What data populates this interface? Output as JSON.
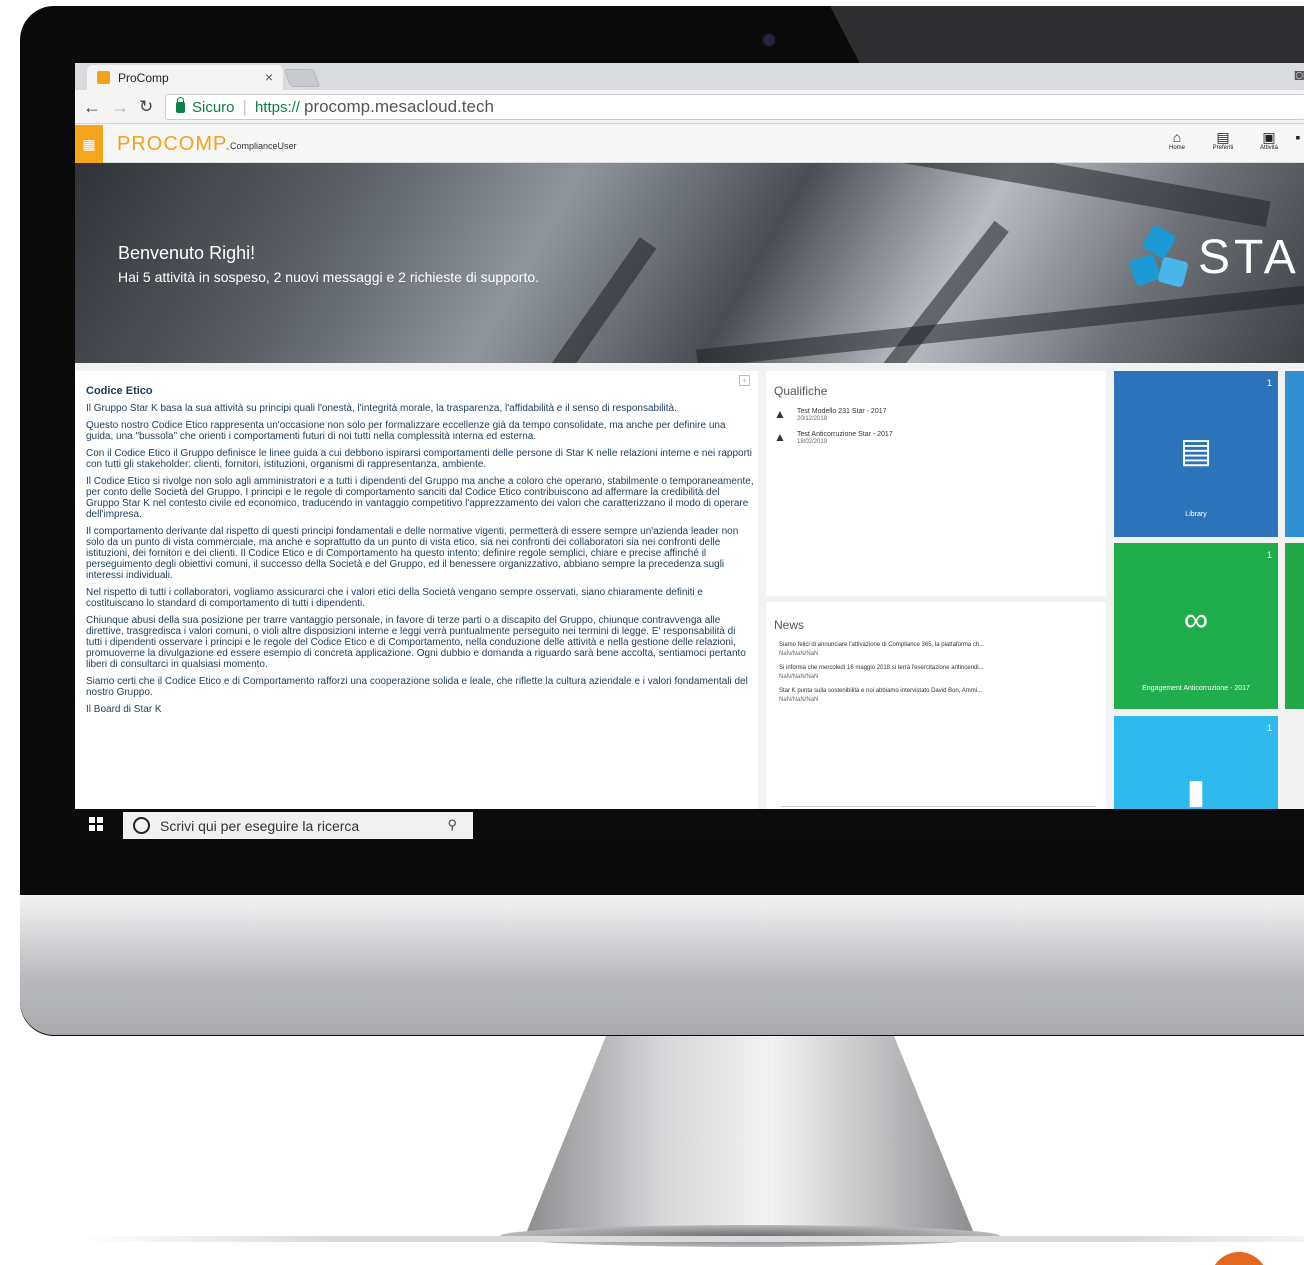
{
  "browser": {
    "tab_title": "ProComp",
    "tab_close": "×",
    "secure_label": "Sicuro",
    "url_scheme": "https://",
    "url_host": "procomp.mesacloud.tech"
  },
  "app": {
    "brand": "PROCOMP.",
    "user": "ComplianceUser",
    "nav": [
      {
        "label": "Home",
        "icon": "home-icon"
      },
      {
        "label": "Preferiti",
        "icon": "favorites-icon"
      },
      {
        "label": "Attività",
        "icon": "clipboard-icon"
      }
    ]
  },
  "hero": {
    "title": "Benvenuto Righi!",
    "subtitle": "Hai 5 attività in sospeso, 2 nuovi messaggi e 2 richieste di supporto.",
    "logo_text": "STA"
  },
  "code_of_ethics": {
    "title": "Codice Etico",
    "paragraphs": [
      "Il Gruppo Star K basa la sua attività su principi quali l'onestà, l'integrità morale, la trasparenza, l'affidabilità e il senso di responsabilità.",
      "Questo nostro Codice Etico rappresenta un'occasione non solo per formalizzare eccellenze già da tempo consolidate, ma anche per definire una guida, una \"bussola\" che orienti i comportamenti futuri di noi tutti nella complessità interna ed esterna.",
      "Con il Codice Etico il Gruppo definisce le linee guida a cui debbono ispirarsi comportamenti delle persone di Star K nelle relazioni interne e nei rapporti con tutti gli stakeholder: clienti, fornitori, istituzioni, organismi di rappresentanza, ambiente.",
      "Il Codice Etico si rivolge non solo agli amministratori e a tutti i dipendenti del Gruppo ma anche a coloro che operano, stabilmente o temporaneamente, per conto delle Società del Gruppo. I principi e le regole di comportamento sanciti dal Codice Etico contribuiscono ad affermare la credibilità del Gruppo Star K nel contesto civile ed economico, traducendo in vantaggio competitivo l'apprezzamento dei valori che caratterizzano il modo di operare dell'impresa.",
      "Il comportamento derivante dal rispetto di questi principi fondamentali e delle normative vigenti, permetterà di essere sempre un'azienda leader non solo da un punto di vista commerciale, ma anche e soprattutto da un punto di vista etico, sia nei confronti dei collaboratori sia nei confronti delle istituzioni, dei fornitori e dei clienti. Il Codice Etico e di Comportamento ha questo intento: definire regole semplici, chiare e precise affinché il perseguimento degli obiettivi comuni, il successo della Società e del Gruppo, ed il benessere organizzativo, abbiano sempre la precedenza sugli interessi individuali.",
      "Nel rispetto di tutti i collaboratori, vogliamo assicurarci che i valori etici della Società vengano sempre osservati, siano chiaramente definiti e costituiscano lo standard di comportamento di tutti i dipendenti.",
      "Chiunque abusi della sua posizione per trarre vantaggio personale, in favore di terze parti o a discapito del Gruppo, chiunque contravvenga alle direttive, trasgredisca i valori comuni, o violi altre disposizioni interne e leggi verrà puntualmente perseguito nei termini di legge. E' responsabilità di tutti i dipendenti osservare i principi e le regole del Codice Etico e di Comportamento, nella conduzione delle attività e nella gestione delle relazioni, promuoverne la divulgazione ed essere esempio di concreta applicazione. Ogni dubbio e domanda a riguardo sarà bene accolta, sentiamoci pertanto liberi di consultarci in qualsiasi momento.",
      "Siamo certi che il Codice Etico e di Comportamento rafforzi una cooperazione solida e leale, che riflette la cultura aziendale e i valori fondamentali del nostro Gruppo.",
      "Il Board di Star K"
    ]
  },
  "qualifications": {
    "title": "Qualifiche",
    "items": [
      {
        "name": "Test Modello 231 Star - 2017",
        "date": "20/12/2018"
      },
      {
        "name": "Test Anticorruzione Star - 2017",
        "date": "18/02/2019"
      }
    ]
  },
  "news": {
    "title": "News",
    "items": [
      {
        "text": "Siamo felici di annunciare l'attivazione di Compliance 365, la piattaforma ch...",
        "meta": "NaN/NaN/NaN"
      },
      {
        "text": "Si informa che mercoledì 16 maggio 2018 si terrà l'esercitazione antincendi...",
        "meta": "NaN/NaN/NaN"
      },
      {
        "text": "Star K punta sulla sostenibilità e noi abbiamo intervistato David Bon, Ammi...",
        "meta": "NaN/NaN/NaN"
      }
    ]
  },
  "tiles": [
    {
      "label": "Library",
      "count": "1",
      "color": "#2c74b9",
      "icon": "library-icon"
    },
    {
      "label": "Engagement Anticorruzione - 2017",
      "count": "1",
      "color": "#1fae4b",
      "icon": "paperclip-icon"
    },
    {
      "label": "",
      "count": "1",
      "color": "#2db9eb",
      "icon": "document-icon"
    }
  ],
  "taskbar": {
    "search_placeholder": "Scrivi qui per eseguire la ricerca"
  }
}
